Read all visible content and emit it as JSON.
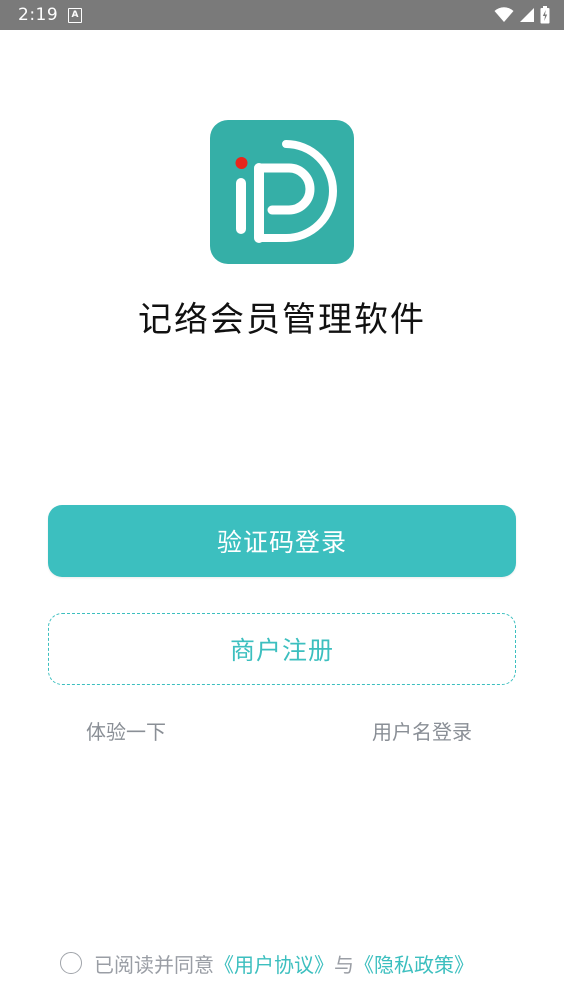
{
  "status_bar": {
    "time": "2:19",
    "notification_icon_letter": "A"
  },
  "app": {
    "title": "记络会员管理软件",
    "logo_bg_color": "#35afa7",
    "logo_dot_color": "#e8261c"
  },
  "actions": {
    "primary_label": "验证码登录",
    "secondary_label": "商户注册",
    "trial_label": "体验一下",
    "username_login_label": "用户名登录"
  },
  "agreement": {
    "prefix": "已阅读并同意",
    "user_agreement": "《用户协议》",
    "joiner": "与",
    "privacy_policy": "《隐私政策》",
    "checked": false
  },
  "colors": {
    "accent": "#3cbfbf",
    "status_bar": "#7a7a7a",
    "muted_text": "#8a8f96"
  }
}
